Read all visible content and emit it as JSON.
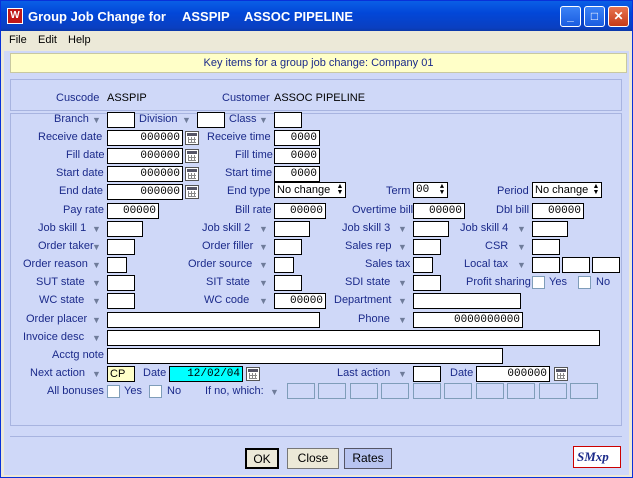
{
  "window": {
    "title": "Group Job Change for",
    "company_code": "ASSPIP",
    "company_name": "ASSOC PIPELINE",
    "menu": [
      "File",
      "Edit",
      "Help"
    ]
  },
  "banner": "Key items for a group job change: Company 01",
  "customer": {
    "cuscode_label": "Cuscode",
    "cuscode_value": "ASSPIP",
    "customer_label": "Customer",
    "customer_value": "ASSOC PIPELINE"
  },
  "labels": {
    "branch": "Branch",
    "division": "Division",
    "class": "Class",
    "receive_date": "Receive date",
    "receive_time": "Receive time",
    "fill_date": "Fill date",
    "fill_time": "Fill time",
    "start_date": "Start date",
    "start_time": "Start time",
    "end_date": "End date",
    "end_type": "End type",
    "term": "Term",
    "period": "Period",
    "pay_rate": "Pay rate",
    "bill_rate": "Bill rate",
    "overtime_bill": "Overtime bill",
    "dbl_bill": "Dbl bill",
    "job_skill_1": "Job skill 1",
    "job_skill_2": "Job skill 2",
    "job_skill_3": "Job skill 3",
    "job_skill_4": "Job skill 4",
    "order_taker": "Order taker",
    "order_filler": "Order filler",
    "sales_rep": "Sales rep",
    "csr": "CSR",
    "order_reason": "Order reason",
    "order_source": "Order source",
    "sales_tax": "Sales tax",
    "local_tax": "Local tax",
    "sut_state": "SUT state",
    "sit_state": "SIT state",
    "sdi_state": "SDI state",
    "profit_sharing": "Profit sharing",
    "yes": "Yes",
    "no": "No",
    "wc_state": "WC state",
    "wc_code": "WC code",
    "department": "Department",
    "order_placer": "Order placer",
    "phone": "Phone",
    "invoice_desc": "Invoice desc",
    "acctg_note": "Acctg note",
    "next_action": "Next action",
    "date": "Date",
    "last_action": "Last action",
    "all_bonuses": "All bonuses",
    "if_no_which": "If no, which:"
  },
  "values": {
    "receive_date": "000000",
    "receive_time": "0000",
    "fill_date": "000000",
    "fill_time": "0000",
    "start_date": "000000",
    "start_time": "0000",
    "end_date": "000000",
    "end_type": "No change",
    "term": "00",
    "period": "No change",
    "pay_rate": "00000",
    "bill_rate": "00000",
    "overtime_bill": "00000",
    "dbl_bill": "00000",
    "wc_code": "00000",
    "phone": "0000000000",
    "next_action": "CP",
    "next_date": "12/02/04",
    "last_date": "000000"
  },
  "buttons": {
    "ok": "OK",
    "close": "Close",
    "rates": "Rates"
  },
  "logo": {
    "text": "SMxp"
  }
}
